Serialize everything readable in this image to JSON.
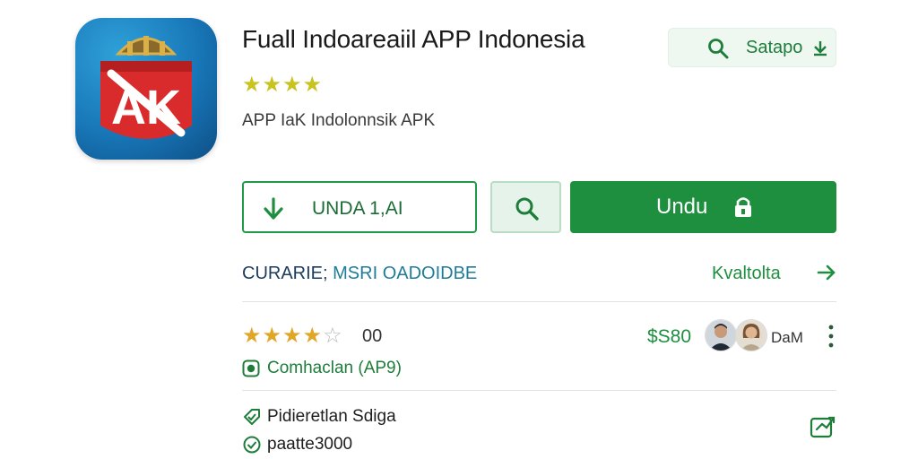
{
  "app": {
    "title": "Fuall Indoareaiil APP Indonesia",
    "rating_stars": "★★★★",
    "subtitle": "APP IaK  Indolonnsik APK",
    "icon_text": "AK",
    "icon_name": "app-logo-icon"
  },
  "search_chip": {
    "label": "Satapo",
    "icon": "search-icon",
    "arrow_icon": "download-arrow-icon"
  },
  "actions": {
    "download_outline_label": "UNDA  1,AI",
    "download_icon": "down-arrow-icon",
    "search_icon": "search-icon",
    "install_label": "Undu",
    "install_icon": "lock-icon"
  },
  "category": {
    "part1": "CURARIE;",
    "part2": " MSRI OADOIDBE",
    "more_label": "Kvaltolta",
    "more_icon": "arrow-right-icon"
  },
  "stats": {
    "stars_full": "★★★★",
    "stars_empty": "☆",
    "rating_count": "00",
    "price": "$S80",
    "developer": "DaM",
    "compat_label": "Comhaclan (AP9)"
  },
  "details": {
    "line1": "Pidieretlan Sdiga",
    "line2": "paatte3000"
  },
  "colors": {
    "accent_green": "#1e8f3f",
    "star_gold": "#e0a626",
    "icon_blue": "#1877b8",
    "icon_red": "#d92b2b"
  }
}
